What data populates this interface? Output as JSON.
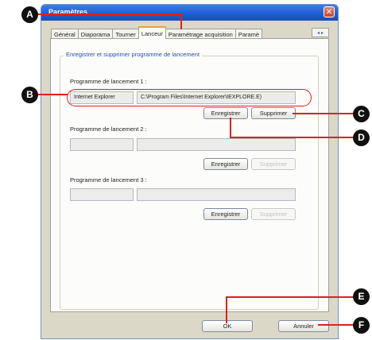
{
  "window": {
    "title": "Paramètres",
    "close_glyph": "✕"
  },
  "tabs": [
    {
      "label": "Général"
    },
    {
      "label": "Diaporama"
    },
    {
      "label": "Tourner"
    },
    {
      "label": "Lanceur",
      "active": true
    },
    {
      "label": "Paramétrage acquisition"
    },
    {
      "label": "Paramè"
    }
  ],
  "tab_scroll": {
    "left": "◂",
    "right": "▸"
  },
  "group": {
    "title": "Enregistrer et supprimer programme de lancement"
  },
  "launchers": [
    {
      "label": "Programme de lancement 1 :",
      "name": "Internet Explorer",
      "path": "C:\\Program Files\\Internet Explorer\\IEXPLORE.E)",
      "save_label": "Enregistrer",
      "delete_label": "Supprimer"
    },
    {
      "label": "Programme de lancement 2 :",
      "name": "",
      "path": "",
      "save_label": "Enregistrer",
      "delete_label": "Supprimer"
    },
    {
      "label": "Programme de lancement 3 :",
      "name": "",
      "path": "",
      "save_label": "Enregistrer",
      "delete_label": "Supprimer"
    }
  ],
  "footer": {
    "ok_label": "OK",
    "cancel_label": "Annuler"
  },
  "callouts": {
    "a": "A",
    "b": "B",
    "c": "C",
    "d": "D",
    "e": "E",
    "f": "F"
  },
  "colors": {
    "title_bar": "#1d5cd1",
    "callout_line": "#e0201b",
    "group_title": "#2450b0"
  }
}
